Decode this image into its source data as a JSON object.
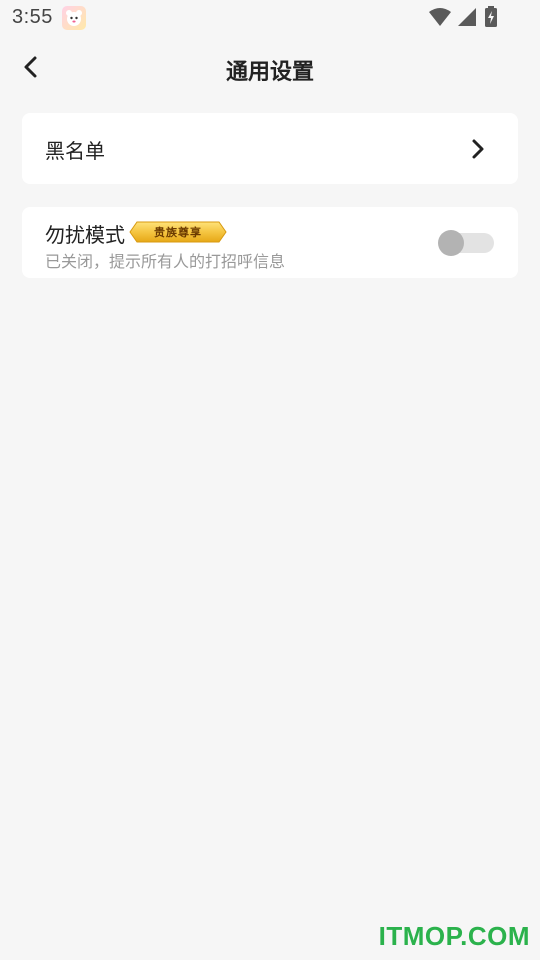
{
  "status_bar": {
    "time": "3:55",
    "icons": [
      "app-notification-icon",
      "wifi-icon",
      "signal-icon",
      "battery-icon"
    ]
  },
  "header": {
    "title": "通用设置",
    "back_icon": "back-arrow-icon"
  },
  "settings": {
    "blacklist": {
      "label": "黑名单",
      "icon": "chevron-right-icon"
    },
    "do_not_disturb": {
      "label": "勿扰模式",
      "badge": "贵族尊享",
      "subtitle": "已关闭，提示所有人的打招呼信息",
      "enabled": false
    }
  },
  "watermark": "ITMOP.COM",
  "colors": {
    "background": "#f6f6f6",
    "card": "#ffffff",
    "badge_gold": "#f5c542",
    "toggle_off_track": "#e3e3e3",
    "toggle_off_knob": "#b3b3b3",
    "watermark": "#2bb24c"
  }
}
